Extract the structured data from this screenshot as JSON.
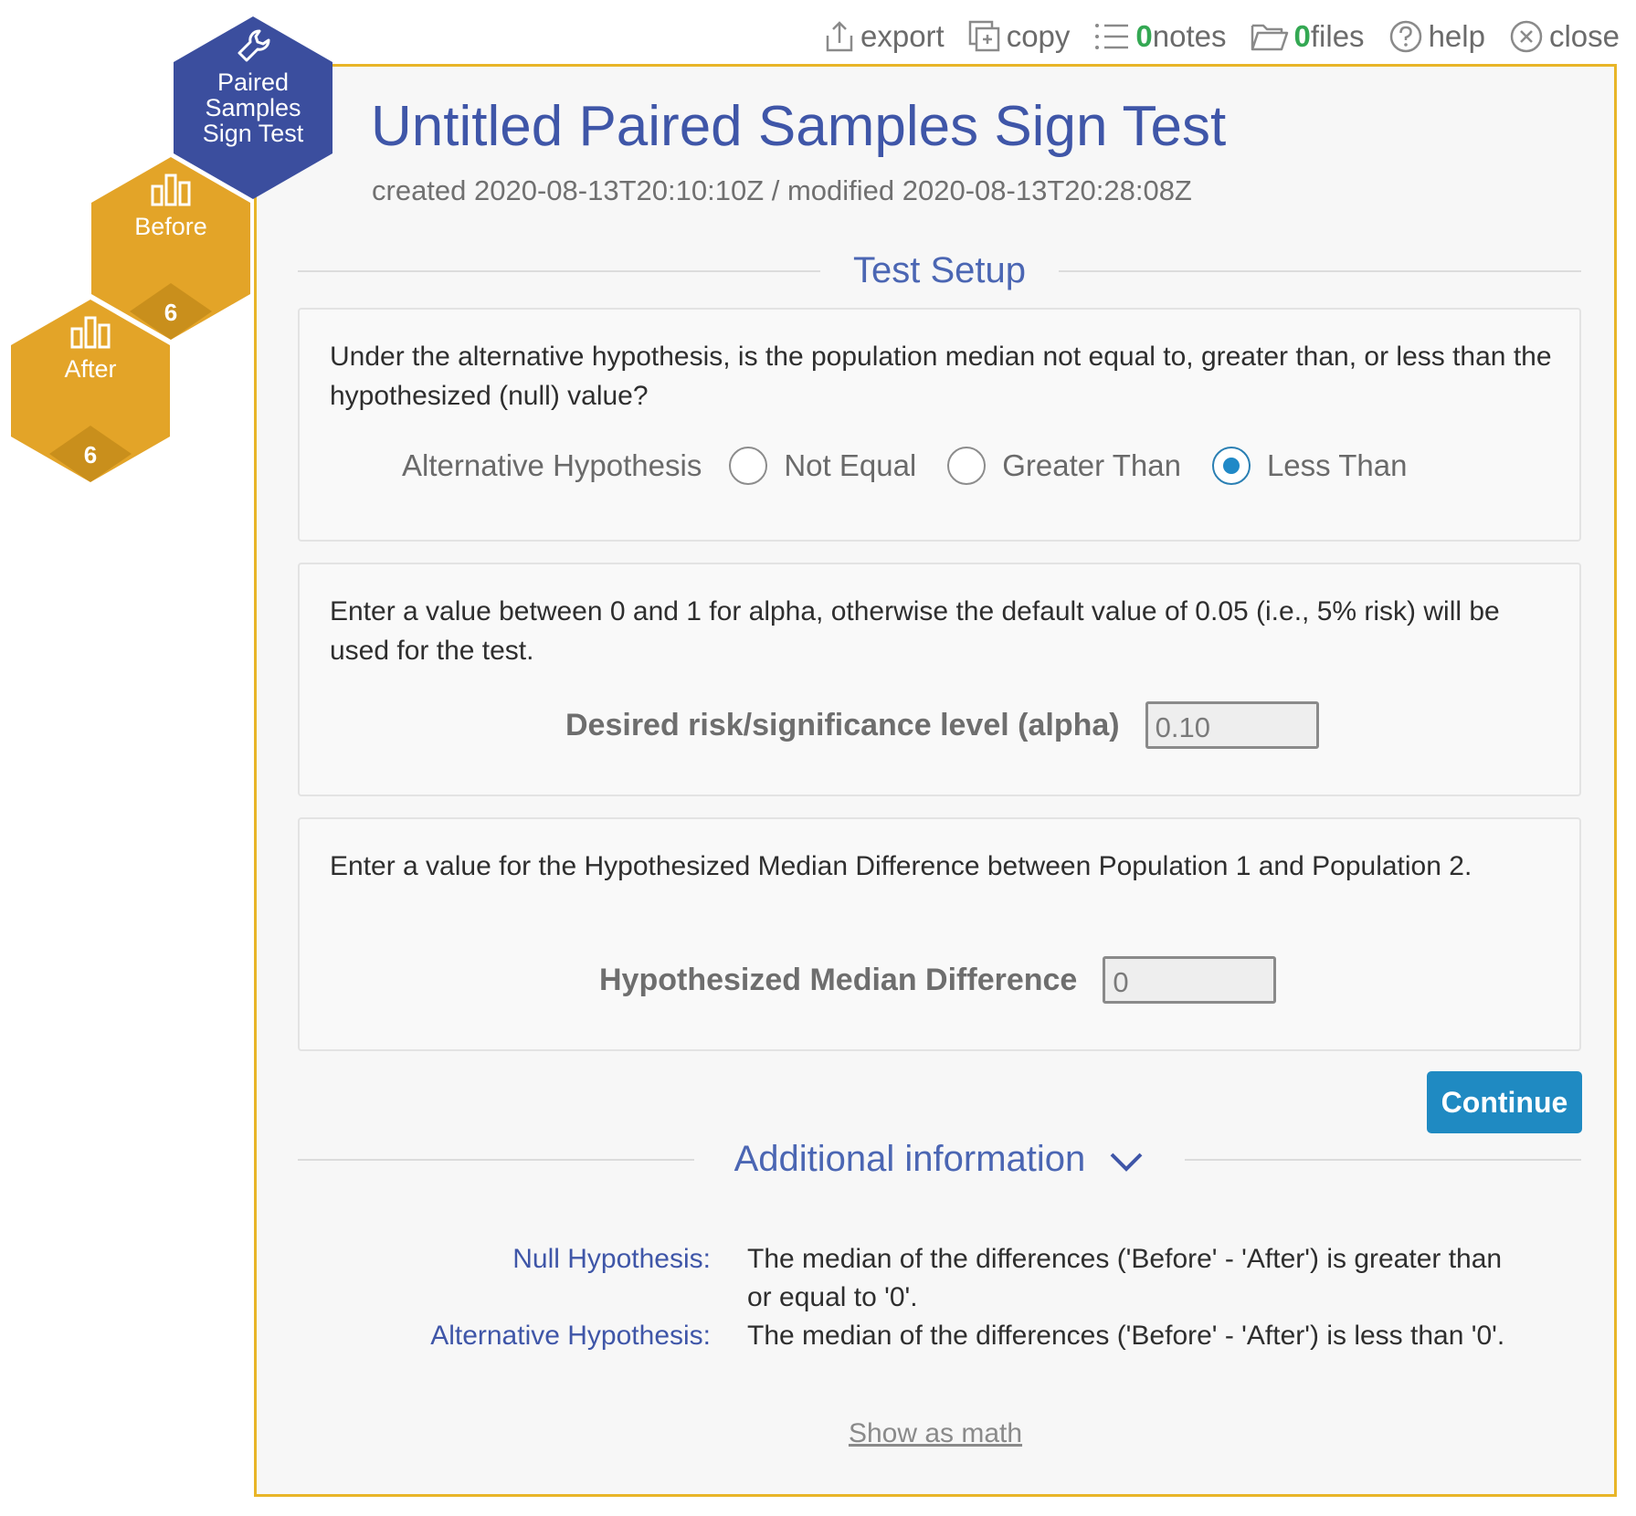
{
  "toolbar": {
    "export_label": "export",
    "copy_label": "copy",
    "notes_count": "0",
    "notes_label": "notes",
    "files_count": "0",
    "files_label": "files",
    "help_label": "help",
    "close_label": "close"
  },
  "nodes": {
    "tool": {
      "line1": "Paired",
      "line2": "Samples",
      "line3": "Sign Test",
      "icon": "wrench-icon"
    },
    "before": {
      "label": "Before",
      "count": "6",
      "icon": "bar-chart-icon"
    },
    "after": {
      "label": "After",
      "count": "6",
      "icon": "bar-chart-icon"
    }
  },
  "header": {
    "title": "Untitled Paired Samples Sign Test",
    "dates": "created 2020-08-13T20:10:10Z / modified 2020-08-13T20:28:08Z"
  },
  "setup": {
    "heading": "Test Setup",
    "hypothesis": {
      "description": "Under the alternative hypothesis, is the population median not equal to, greater than, or less than the hypothesized (null) value?",
      "label": "Alternative Hypothesis",
      "options": [
        "Not Equal",
        "Greater Than",
        "Less Than"
      ],
      "selected": "Less Than"
    },
    "alpha": {
      "description": "Enter a value between 0 and 1 for alpha, otherwise the default value of 0.05 (i.e., 5% risk) will be used for the test.",
      "label": "Desired risk/significance level (alpha)",
      "value": "0.10"
    },
    "median": {
      "description": "Enter a value for the Hypothesized Median Difference between Population 1 and Population 2.",
      "label": "Hypothesized Median Difference",
      "value": "0"
    },
    "continue_label": "Continue"
  },
  "additional": {
    "heading": "Additional information",
    "null_label": "Null Hypothesis:",
    "null_text": "The median of the differences ('Before' - 'After') is greater than or equal to '0'.",
    "alt_label": "Alternative Hypothesis:",
    "alt_text": "The median of the differences ('Before' - 'After') is less than '0'.",
    "show_math": "Show as math"
  },
  "colors": {
    "accent_blue": "#3f56a8",
    "panel_border": "#e8b528",
    "hex_tool": "#3b4e9e",
    "hex_data": "#e3a428",
    "button": "#1f8ac2",
    "count_green": "#34a853"
  }
}
